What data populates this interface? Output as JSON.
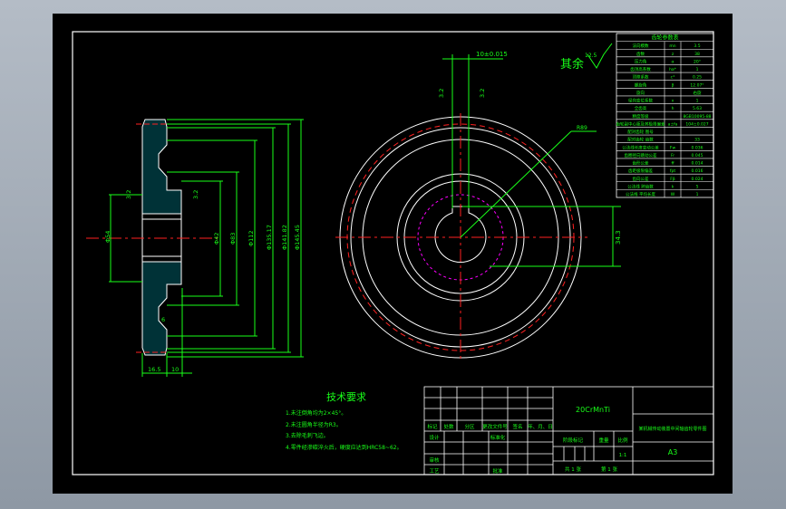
{
  "drawing": {
    "tech_requirements": {
      "title": "技术要求",
      "items": [
        "1.未注倒角均为2×45°。",
        "2.未注圆角半径为R3。",
        "3.去除毛刺飞边。",
        "4.零件经渗碳淬火后，硬度应达到HRC58~62。"
      ]
    },
    "roughness_rest": {
      "label": "其余",
      "value": "12.5"
    },
    "keyway_width": "10±0.015",
    "keyway_depth": "34.3",
    "radius_note": "R89",
    "roughness_marks": [
      "3.2",
      "3.2",
      "3.2",
      "3.2"
    ],
    "side_dims": {
      "bore": "Φ54",
      "d1": "Φ42",
      "d2": "Φ83",
      "d3": "Φ112",
      "d4": "Φ135.17",
      "d5": "Φ141.82",
      "d6": "Φ145.45",
      "width1": "16.5",
      "width2": "10",
      "web": "6"
    },
    "gear_table": {
      "title": "齿轮参数表",
      "rows": [
        [
          "法向模数",
          "mn",
          "3.5"
        ],
        [
          "齿数",
          "z",
          "38"
        ],
        [
          "压力角",
          "α",
          "20°"
        ],
        [
          "齿顶高系数",
          "ha*",
          "1"
        ],
        [
          "顶隙系数",
          "c*",
          "0.25"
        ],
        [
          "螺旋角",
          "β",
          "12.07°"
        ],
        [
          "旋向",
          "",
          "右旋"
        ],
        [
          "径向变位系数",
          "x",
          "1"
        ],
        [
          "全齿高",
          "h",
          "5.63"
        ],
        [
          "精度等级",
          "",
          "8GB10095-88"
        ],
        [
          "齿轮副中心距及其极限偏差",
          "a±fa",
          "104±0.027"
        ],
        [
          "配对齿轮 图号",
          "",
          ""
        ],
        [
          "配对齿轮 齿数",
          "",
          "33"
        ],
        [
          "公法线长度变动公差",
          "Fw",
          "0.036"
        ],
        [
          "齿圈径向跳动公差",
          "Fr",
          "0.045"
        ],
        [
          "齿形公差",
          "ff",
          "0.014"
        ],
        [
          "齿距极限偏差",
          "fpt",
          "0.016"
        ],
        [
          "齿向公差",
          "Fβ",
          "0.024"
        ],
        [
          "公法线 跨齿数",
          "k",
          "5"
        ],
        [
          "公法线 平均长度",
          "W",
          "1"
        ]
      ]
    },
    "title_block": {
      "material": "20CrMnTi",
      "drawing_name": "某机械传动装置中间轴齿轮零件图",
      "drawing_no": "A3",
      "headers": [
        "标记",
        "处数",
        "分区",
        "更改文件号",
        "签名",
        "年、月、日"
      ],
      "design": "设计",
      "standardize": "标准化",
      "review": "审核",
      "process": "工艺",
      "approve": "批准",
      "stage_mark": "阶段标记",
      "weight": "重量",
      "scale_label": "比例",
      "scale": "1:1",
      "sheets": "共 1 张",
      "sheet_no": "第 1 张"
    }
  }
}
